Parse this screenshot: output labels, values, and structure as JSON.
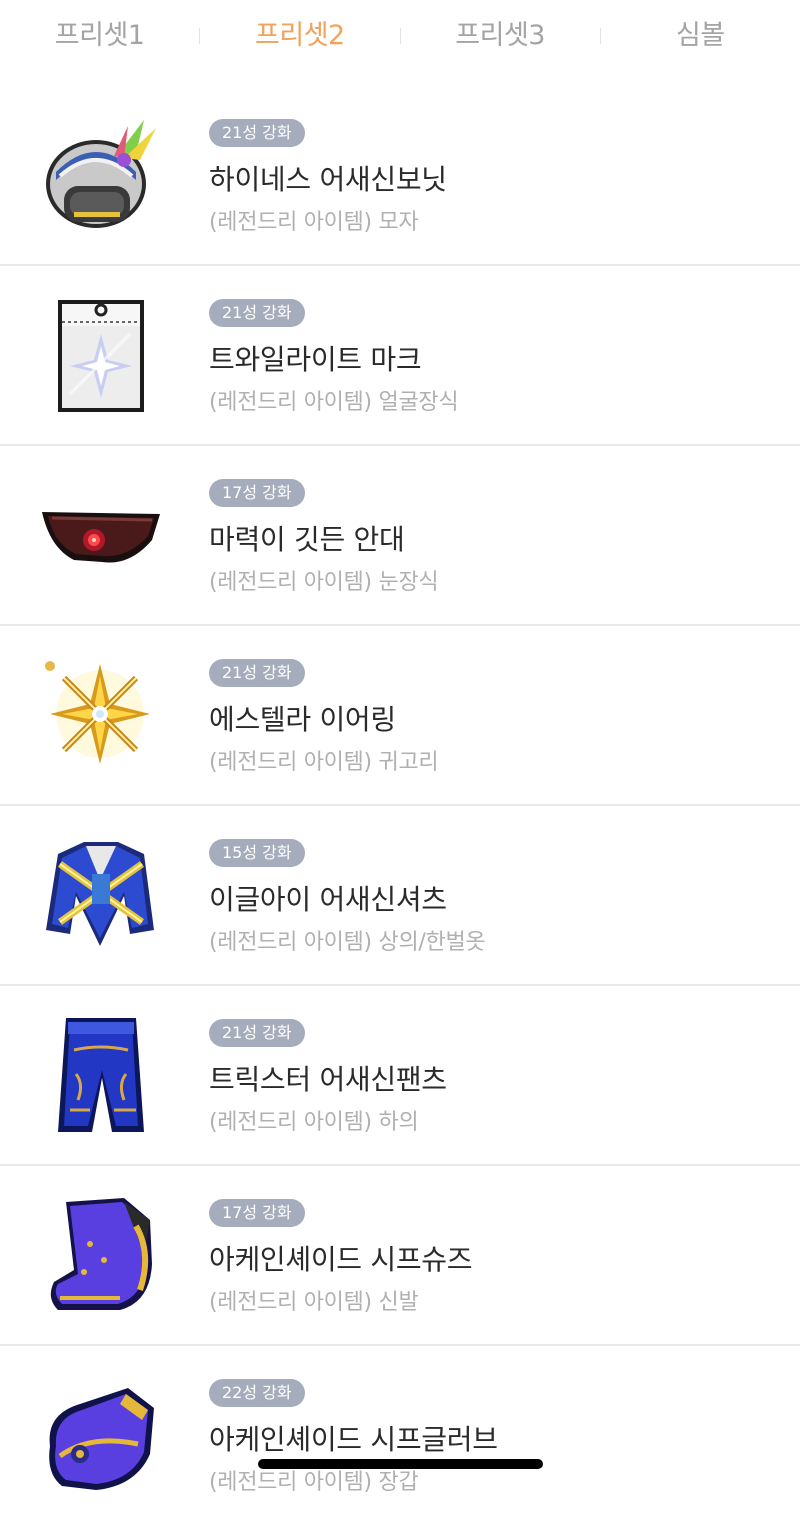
{
  "tabs": [
    {
      "label": "프리셋1",
      "active": false
    },
    {
      "label": "프리셋2",
      "active": true
    },
    {
      "label": "프리셋3",
      "active": false
    },
    {
      "label": "심볼",
      "active": false
    }
  ],
  "colors": {
    "active_tab": "#f2a25b",
    "inactive_tab": "#a4a4a4",
    "badge_bg": "#a5acbc"
  },
  "items": [
    {
      "badge": "21성 강화",
      "name": "하이네스 어새신보닛",
      "sub": "(레전드리 아이템) 모자",
      "icon": "hat-icon"
    },
    {
      "badge": "21성 강화",
      "name": "트와일라이트 마크",
      "sub": "(레전드리 아이템) 얼굴장식",
      "icon": "face-accessory-icon"
    },
    {
      "badge": "17성 강화",
      "name": "마력이 깃든 안대",
      "sub": "(레전드리 아이템) 눈장식",
      "icon": "eye-patch-icon"
    },
    {
      "badge": "21성 강화",
      "name": "에스텔라 이어링",
      "sub": "(레전드리 아이템) 귀고리",
      "icon": "earring-icon"
    },
    {
      "badge": "15성 강화",
      "name": "이글아이 어새신셔츠",
      "sub": "(레전드리 아이템) 상의/한벌옷",
      "icon": "shirt-icon"
    },
    {
      "badge": "21성 강화",
      "name": "트릭스터 어새신팬츠",
      "sub": "(레전드리 아이템) 하의",
      "icon": "pants-icon"
    },
    {
      "badge": "17성 강화",
      "name": "아케인셰이드 시프슈즈",
      "sub": "(레전드리 아이템) 신발",
      "icon": "shoes-icon"
    },
    {
      "badge": "22성 강화",
      "name": "아케인셰이드 시프글러브",
      "sub": "(레전드리 아이템) 장갑",
      "icon": "gloves-icon"
    }
  ]
}
